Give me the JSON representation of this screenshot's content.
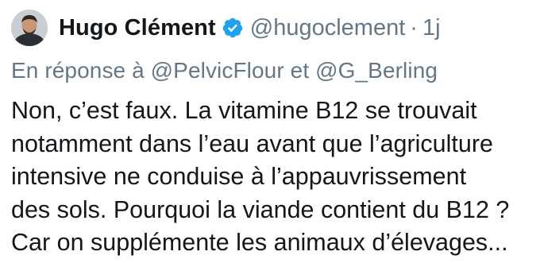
{
  "tweet": {
    "author": {
      "display_name": "Hugo Clément",
      "handle": "@hugoclement",
      "verified_icon": "verified-badge-icon"
    },
    "separator": "·",
    "time": "1j",
    "reply": {
      "prefix": "En réponse à",
      "mention_1": "@PelvicFlour",
      "conjunction": "et",
      "mention_2": "@G_Berling"
    },
    "text_lines": [
      "Non, c’est faux. La vitamine B12 se trouvait",
      "notamment dans l’eau avant que l’agriculture",
      "intensive ne conduise à l’appauvrissement",
      "des sols. Pourquoi la viande contient du B12 ?",
      "Car on supplémente les animaux d’élevages..."
    ]
  },
  "colors": {
    "text": "#14171a",
    "secondary": "#657786",
    "verified": "#1da1f2"
  }
}
